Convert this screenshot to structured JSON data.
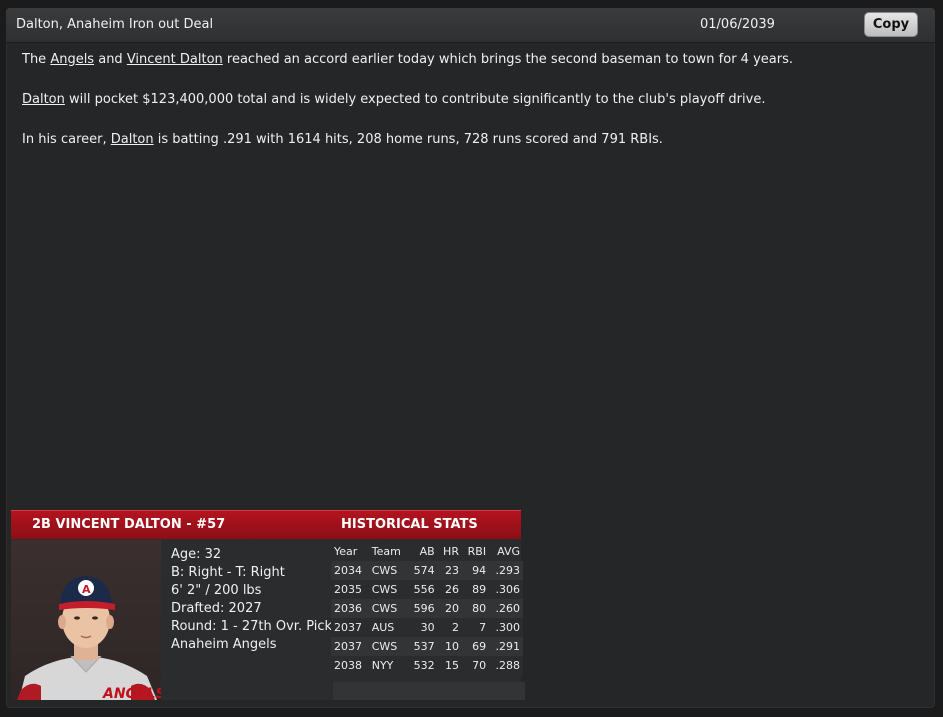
{
  "header": {
    "title": "Dalton, Anaheim Iron out Deal",
    "date": "01/06/2039",
    "copy_label": "Copy"
  },
  "article": {
    "p1": {
      "t1": "The ",
      "team": "Angels",
      "t2": " and ",
      "player": "Vincent Dalton",
      "t3": " reached an accord earlier today which brings the second baseman to town for 4 years."
    },
    "p2": {
      "player": "Dalton",
      "t1": " will pocket $123,400,000 total and is widely expected to contribute significantly to the club's playoff drive."
    },
    "p3": {
      "t1": "In his career, ",
      "player": "Dalton",
      "t2": " is batting .291 with 1614 hits, 208 home runs, 728 runs scored and 791 RBIs."
    }
  },
  "player_card": {
    "name_line": "2B VINCENT DALTON - #57",
    "stats_title": "HISTORICAL STATS",
    "bio": {
      "age": "Age: 32",
      "bats_throws": "B: Right - T: Right",
      "height_weight": "6' 2\" / 200 lbs",
      "drafted": "Drafted: 2027",
      "round": "Round: 1 - 27th Ovr. Pick",
      "team": "Anaheim Angels"
    },
    "photo_cap_letter": "A",
    "jersey_text": "ANGELS",
    "colors": {
      "header_red": "#b3141f",
      "cap_navy": "#1c2a4a",
      "cap_red": "#c41e2a"
    }
  },
  "stats": {
    "headers": [
      "Year",
      "Team",
      "AB",
      "HR",
      "RBI",
      "AVG"
    ],
    "rows": [
      [
        "2034",
        "CWS",
        "574",
        "23",
        "94",
        ".293"
      ],
      [
        "2035",
        "CWS",
        "556",
        "26",
        "89",
        ".306"
      ],
      [
        "2036",
        "CWS",
        "596",
        "20",
        "80",
        ".260"
      ],
      [
        "2037",
        "AUS",
        "30",
        "2",
        "7",
        ".300"
      ],
      [
        "2037",
        "CWS",
        "537",
        "10",
        "69",
        ".291"
      ],
      [
        "2038",
        "NYY",
        "532",
        "15",
        "70",
        ".288"
      ]
    ]
  }
}
